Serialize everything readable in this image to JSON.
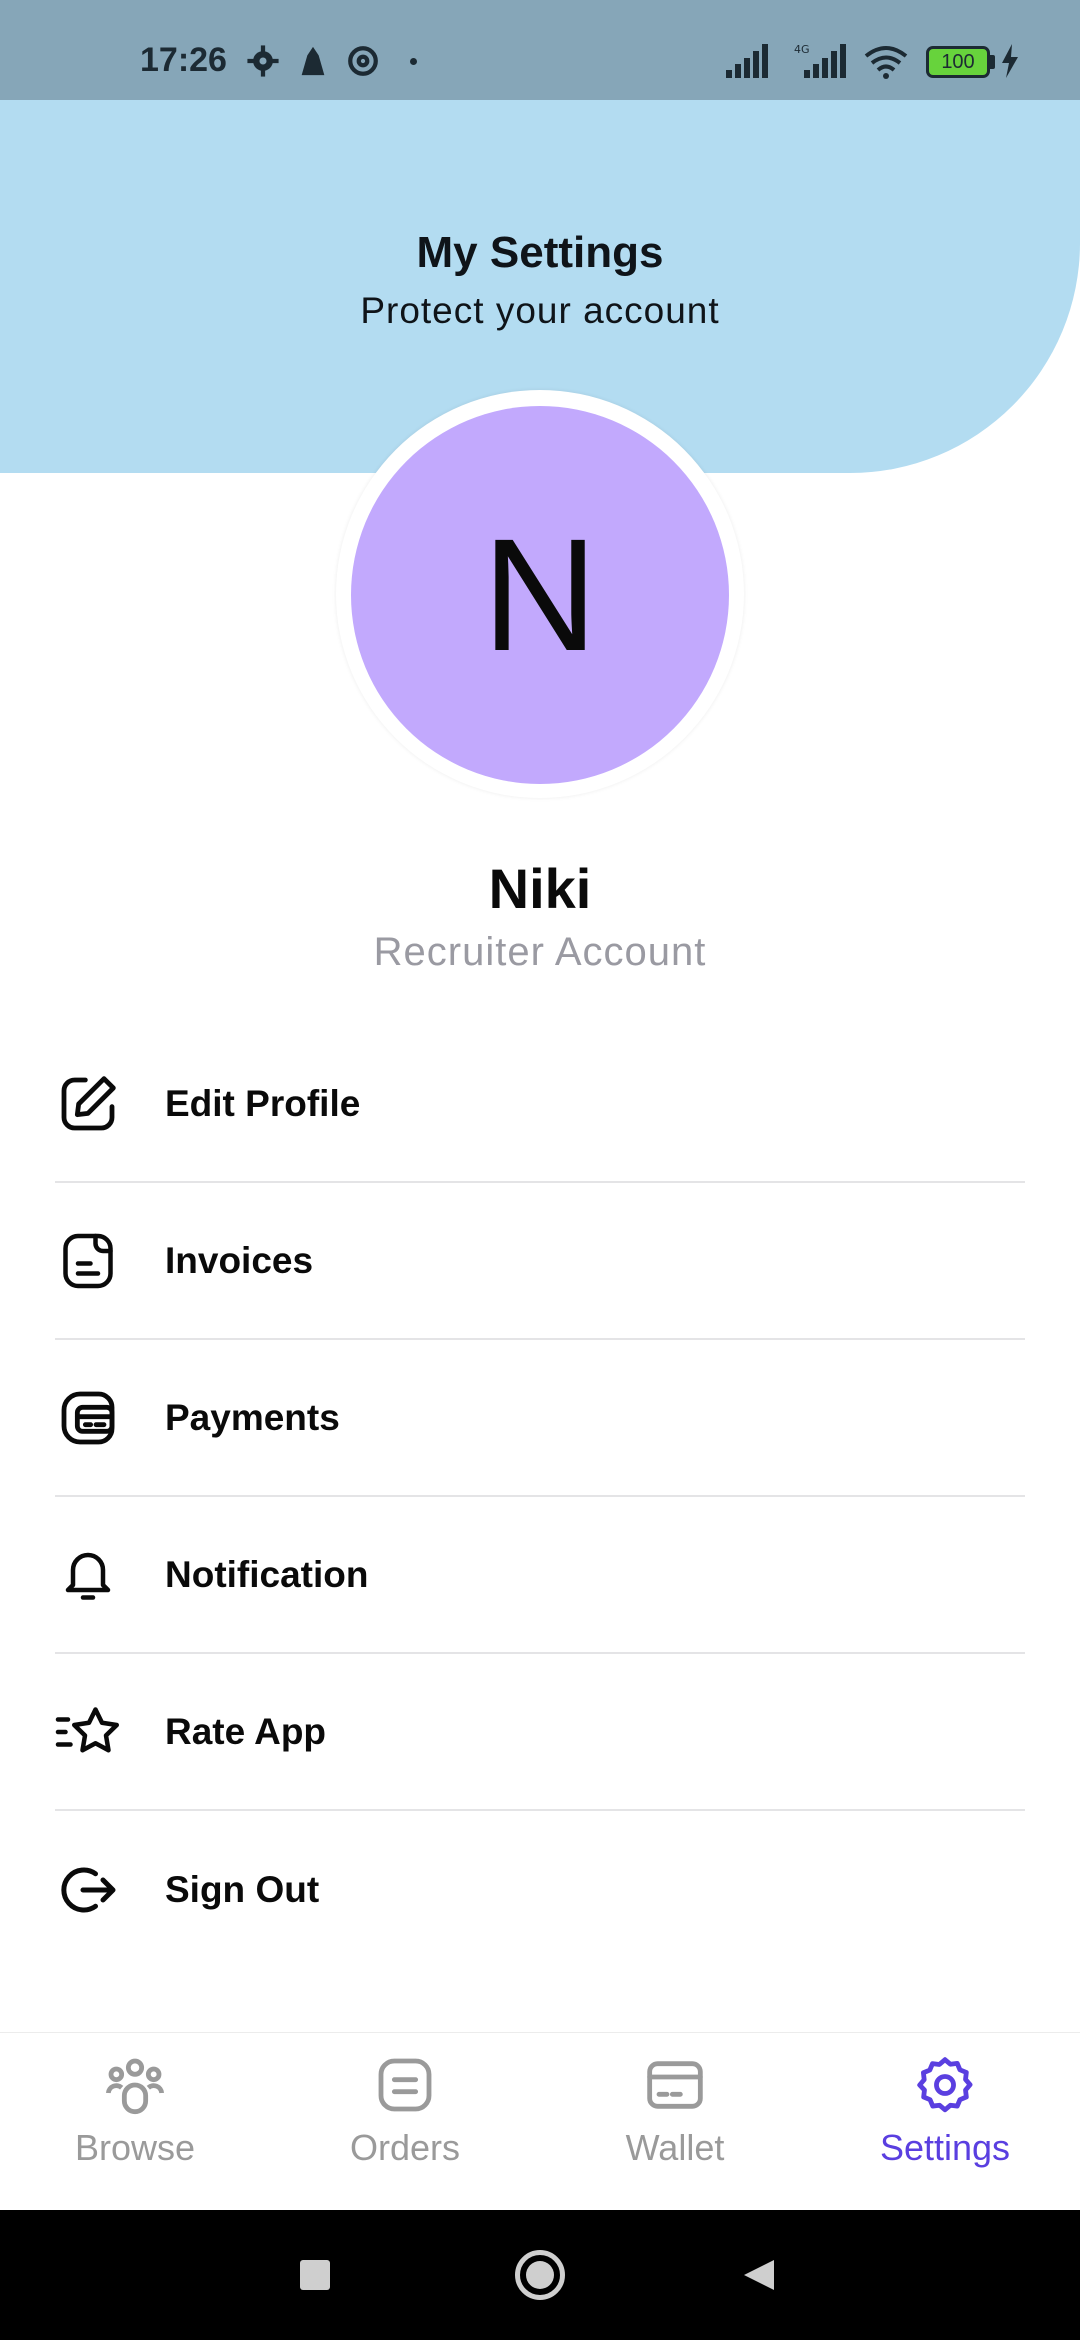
{
  "status_bar": {
    "time": "17:26",
    "battery": "100",
    "network": "4G"
  },
  "header": {
    "title": "My Settings",
    "subtitle": "Protect your account"
  },
  "profile": {
    "initial": "N",
    "name": "Niki",
    "role": "Recruiter Account"
  },
  "menu": {
    "items": [
      {
        "label": "Edit Profile",
        "icon": "edit-icon"
      },
      {
        "label": "Invoices",
        "icon": "invoice-icon"
      },
      {
        "label": "Payments",
        "icon": "payments-icon"
      },
      {
        "label": "Notification",
        "icon": "bell-icon"
      },
      {
        "label": "Rate App",
        "icon": "star-icon"
      },
      {
        "label": "Sign Out",
        "icon": "sign-out-icon"
      }
    ]
  },
  "bottom_nav": {
    "items": [
      {
        "label": "Browse",
        "icon": "users-icon",
        "active": false
      },
      {
        "label": "Orders",
        "icon": "orders-icon",
        "active": false
      },
      {
        "label": "Wallet",
        "icon": "wallet-icon",
        "active": false
      },
      {
        "label": "Settings",
        "icon": "gear-icon",
        "active": true
      }
    ]
  },
  "colors": {
    "header_bg": "#b3dcf1",
    "avatar_bg": "#c2a9fd",
    "accent": "#5a3fe0",
    "inactive": "#9a9a9a"
  }
}
